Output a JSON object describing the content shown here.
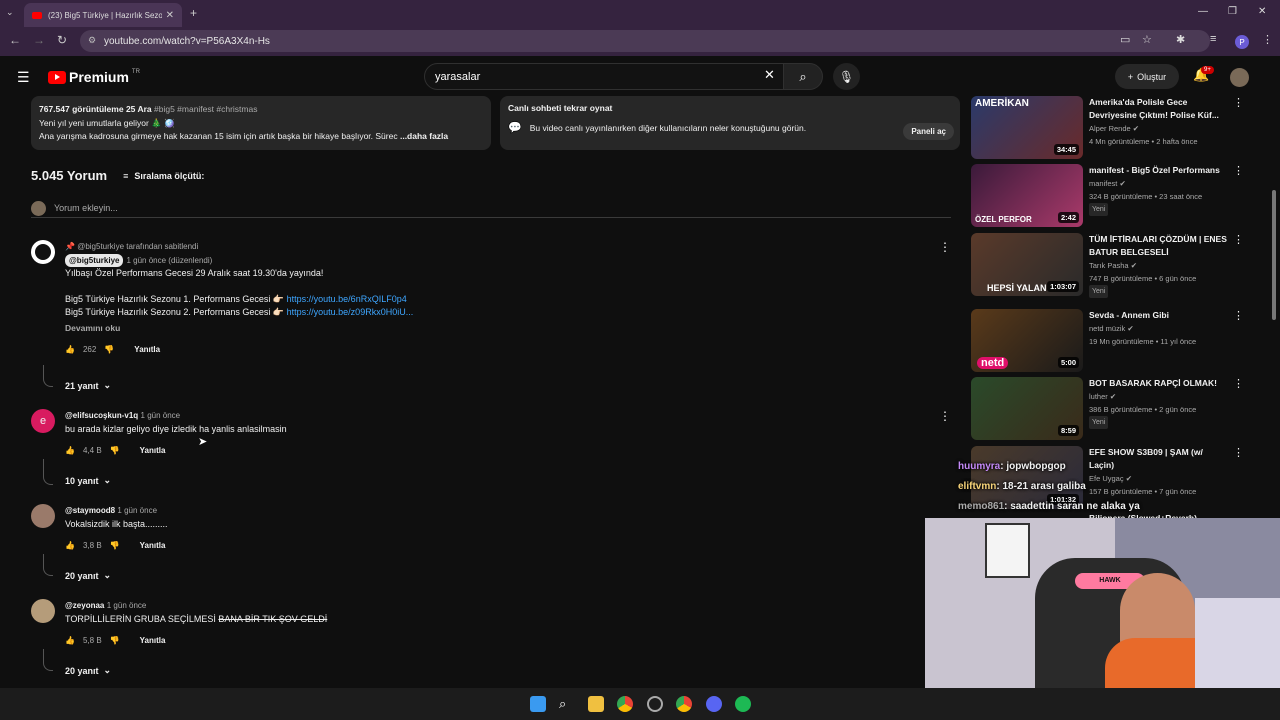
{
  "browser": {
    "tab_title": "(23) Big5 Türkiye | Hazırlık Sezo",
    "url": "youtube.com/watch?v=P56A3X4n-Hs",
    "profile_initial": "P"
  },
  "header": {
    "logo": "Premium",
    "logo_region": "TR",
    "search_value": "yarasalar",
    "create_label": "Oluştur",
    "notif_badge": "9+"
  },
  "description": {
    "views": "767.547 görüntüleme",
    "date": "25 Ara",
    "tags": "#big5 #manifest #christmas",
    "line1": "Yeni yıl yeni umutlarla geliyor 🎄 🪩",
    "line2": "Ana yarışma kadrosuna girmeye hak kazanan 15 isim için artık başka bir hikaye başlıyor. Sürec",
    "more": "...daha fazla"
  },
  "chat_replay": {
    "title": "Canlı sohbeti tekrar oynat",
    "text": "Bu video canlı yayınlanırken diğer kullanıcıların neler konuştuğunu görün.",
    "button": "Paneli aç"
  },
  "comments_header": {
    "count": "5.045 Yorum",
    "sort": "Sıralama ölçütü:",
    "add_placeholder": "Yorum ekleyin..."
  },
  "comments": [
    {
      "pinned": "@big5turkiye tarafından sabitlendi",
      "user": "@big5turkiye",
      "time": "1 gün önce (düzenlendi)",
      "line1": "Yılbaşı Özel Performans Gecesi 29 Aralık saat 19.30'da yayında!",
      "line2": "Big5 Türkiye Hazırlık Sezonu 1. Performans Gecesi 👉🏻",
      "link2": "https://youtu.be/6nRxQILF0p4",
      "line3": "Big5 Türkiye Hazırlık Sezonu 2. Performans Gecesi 👉🏻",
      "link3": "https://youtu.be/z09Rkx0H0iU...",
      "readmore": "Devamını oku",
      "likes": "262",
      "reply": "Yanıtla",
      "replies": "21 yanıt"
    },
    {
      "user": "@elifsucoşkun-v1q",
      "time": "1 gün önce",
      "text": "bu arada kizlar geliyo diye izledik ha yanlis anlasilmasin",
      "likes": "4,4 B",
      "reply": "Yanıtla",
      "replies": "10 yanıt",
      "avatar_letter": "e"
    },
    {
      "user": "@staymood8",
      "time": "1 gün önce",
      "text": "Vokalsizdik ilk başta.........",
      "likes": "3,8 B",
      "reply": "Yanıtla",
      "replies": "20 yanıt"
    },
    {
      "user": "@zeyonaa",
      "time": "1 gün önce",
      "text": "TORPİLLİLERİN GRUBA SEÇİLMESİ",
      "text_strike": "BANA BİR TIK ŞOV GELDİ",
      "likes": "5,8 B",
      "reply": "Yanıtla",
      "replies": "20 yanıt"
    }
  ],
  "recommendations": [
    {
      "title": "Amerika'da Polisle Gece Devriyesine Çıktım! Polise Küf...",
      "channel": "Alper Rende",
      "meta": "4 Mn görüntüleme • 2 hafta önce",
      "duration": "34:45",
      "thumb_text": "AMERİKAN",
      "new": ""
    },
    {
      "title": "manifest - Big5 Özel Performans",
      "channel": "manifest",
      "meta": "324 B görüntüleme • 23 saat önce",
      "duration": "2:42",
      "thumb_text": "ÖZEL PERFOR",
      "new": "Yeni"
    },
    {
      "title": "TÜM İFTİRALARI ÇÖZDÜM | ENES BATUR BELGESELİ",
      "channel": "Tarık Pasha",
      "meta": "747 B görüntüleme • 6 gün önce",
      "duration": "1:03:07",
      "thumb_text": "HEPSİ YALAN",
      "new": "Yeni"
    },
    {
      "title": "Sevda - Annem Gibi",
      "channel": "netd müzik",
      "meta": "19 Mn görüntüleme • 11 yıl önce",
      "duration": "5:00",
      "thumb_text": "netd",
      "new": ""
    },
    {
      "title": "BOT BASARAK RAPÇİ OLMAK!",
      "channel": "luther",
      "meta": "386 B görüntüleme • 2 gün önce",
      "duration": "8:59",
      "thumb_text": "",
      "new": "Yeni"
    },
    {
      "title": "EFE SHOW S3B09 | ŞAM (w/ Laçin)",
      "channel": "Efe Uygaç",
      "meta": "157 B görüntüleme • 7 gün önce",
      "duration": "1:01:32",
      "thumb_text": "",
      "new": ""
    }
  ],
  "rec7_partial": "Bilionera (Slowed+Reverb) -",
  "chat_overlay": [
    {
      "name": "huumyra",
      "msg": ": jopwbopgop"
    },
    {
      "name": "eliftvmn",
      "msg": ": 18-21 arası galiba"
    },
    {
      "name": "memo861",
      "msg": ": saadettin saran ne alaka ya"
    }
  ],
  "colors": {
    "accent": "#ff0000",
    "link": "#3ea6ff",
    "bg": "#0f0f0f"
  }
}
